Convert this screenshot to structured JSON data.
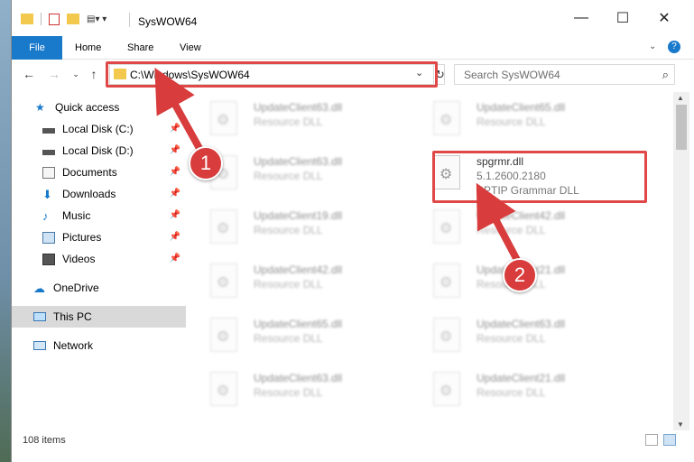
{
  "window": {
    "title": "SysWOW64"
  },
  "tabs": [
    {
      "label": "File"
    },
    {
      "label": "Home"
    },
    {
      "label": "Share"
    },
    {
      "label": "View"
    }
  ],
  "address": {
    "path": "C:\\Windows\\SysWOW64"
  },
  "search": {
    "placeholder": "Search SysWOW64"
  },
  "sidebar": {
    "items": [
      {
        "label": "Quick access",
        "icon": "star-icon"
      },
      {
        "label": "Local Disk (C:)",
        "icon": "drive-icon"
      },
      {
        "label": "Local Disk (D:)",
        "icon": "drive-icon"
      },
      {
        "label": "Documents",
        "icon": "documents-icon"
      },
      {
        "label": "Downloads",
        "icon": "download-icon"
      },
      {
        "label": "Music",
        "icon": "music-icon"
      },
      {
        "label": "Pictures",
        "icon": "pictures-icon"
      },
      {
        "label": "Videos",
        "icon": "videos-icon"
      },
      {
        "label": "OneDrive",
        "icon": "cloud-icon"
      },
      {
        "label": "This PC",
        "icon": "pc-icon"
      },
      {
        "label": "Network",
        "icon": "network-icon"
      }
    ]
  },
  "files": [
    {
      "name": "UpdateClient63.dll",
      "desc": "Resource DLL"
    },
    {
      "name": "UpdateClient65.dll",
      "desc": "Resource DLL"
    },
    {
      "name": "UpdateClient63.dll",
      "desc": "Resource DLL"
    },
    {
      "name": "spgrmr.dll",
      "desc": "5.1.2600.2180",
      "extra": "SPTIP Grammar DLL"
    },
    {
      "name": "UpdateClient19.dll",
      "desc": "Resource DLL"
    },
    {
      "name": "UpdateClient42.dll",
      "desc": "Resource DLL"
    },
    {
      "name": "UpdateClient42.dll",
      "desc": "Resource DLL"
    },
    {
      "name": "UpdateClient21.dll",
      "desc": "Resource DLL"
    },
    {
      "name": "UpdateClient65.dll",
      "desc": "Resource DLL"
    },
    {
      "name": "UpdateClient63.dll",
      "desc": "Resource DLL"
    },
    {
      "name": "UpdateClient63.dll",
      "desc": "Resource DLL"
    },
    {
      "name": "UpdateClient21.dll",
      "desc": "Resource DLL"
    }
  ],
  "status": {
    "count": "108 items"
  },
  "annotations": {
    "step1": "1",
    "step2": "2",
    "color": "#d83c3c"
  },
  "colors": {
    "accent": "#1979ca",
    "highlight": "#e04848"
  }
}
